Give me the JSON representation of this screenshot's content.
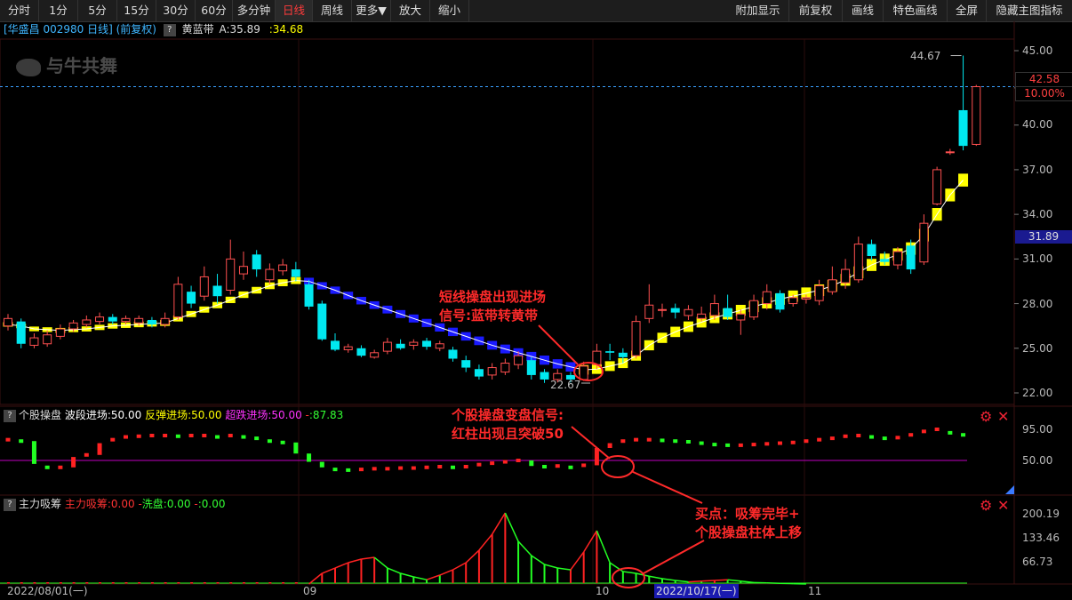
{
  "toolbar": {
    "left": [
      "分时",
      "1分",
      "5分",
      "15分",
      "30分",
      "60分",
      "多分钟",
      "日线",
      "周线",
      "更多▼",
      "放大",
      "缩小"
    ],
    "right": [
      "附加显示",
      "前复权",
      "画线",
      "特色画线",
      "全屏",
      "隐藏主图指标"
    ],
    "active": "日线"
  },
  "info": {
    "stock": "[华盛昌 002980 日线] (前复权)",
    "help": "?",
    "indicator_name": "黄蓝带",
    "a_label": "A:35.89",
    "b_value": ":34.68"
  },
  "watermark": "与牛共舞",
  "price_axis": {
    "ticks": [
      "45.00",
      "42.50",
      "40.00",
      "37.00",
      "34.00",
      "31.00",
      "28.00",
      "25.00",
      "22.00"
    ],
    "tick_values": [
      45.0,
      42.5,
      40.0,
      37.0,
      34.0,
      31.0,
      28.0,
      25.0,
      22.0
    ],
    "current_price": "42.58",
    "current_pct": "10.00%",
    "band_value": "31.89"
  },
  "main_labels": {
    "high": "44.67",
    "low": "22.67"
  },
  "panel2": {
    "name": "个股操盘",
    "wave_label": "波段进场:50.00",
    "rebound_label": "反弹进场:50.00",
    "oversold_label": "超跌进场:50.00",
    "value_label": ":87.83",
    "axis": [
      "95.00",
      "50.00"
    ]
  },
  "panel3": {
    "name": "主力吸筹",
    "main_label": "主力吸筹:0.00",
    "wash_label": "洗盘:0.00",
    "value_label": ":0.00",
    "axis": [
      "200.19",
      "133.46",
      "66.73"
    ]
  },
  "dates": {
    "start": "2022/08/01(一)",
    "sep": "09",
    "oct": "10",
    "cursor": "2022/10/17(一)",
    "nov": "11"
  },
  "annotations": {
    "a1": [
      "短线操盘出现进场",
      "信号:蓝带转黄带"
    ],
    "a2": [
      "个股操盘变盘信号:",
      "红柱出现且突破50"
    ],
    "a3": [
      "买点：吸筹完毕+",
      "个股操盘柱体上移"
    ]
  },
  "colors": {
    "up": "#ff5050",
    "down": "#00e8f0",
    "yellow_band": "#ffff00",
    "blue_band": "#1a1aff",
    "annotation": "#ff2a2a",
    "purple_line": "#c000c0"
  },
  "chart_data": {
    "type": "candlestick",
    "ylim": [
      21.5,
      46.0
    ],
    "candles": [
      {
        "o": 26.5,
        "c": 27.0,
        "h": 27.3,
        "l": 26.2
      },
      {
        "o": 26.8,
        "c": 25.3,
        "h": 27.0,
        "l": 25.0
      },
      {
        "o": 25.2,
        "c": 25.7,
        "h": 26.0,
        "l": 25.0
      },
      {
        "o": 25.3,
        "c": 25.9,
        "h": 26.2,
        "l": 25.1
      },
      {
        "o": 25.8,
        "c": 26.3,
        "h": 26.6,
        "l": 25.6
      },
      {
        "o": 26.3,
        "c": 26.7,
        "h": 26.9,
        "l": 26.1
      },
      {
        "o": 26.6,
        "c": 26.9,
        "h": 27.2,
        "l": 26.4
      },
      {
        "o": 26.8,
        "c": 27.1,
        "h": 27.4,
        "l": 26.6
      },
      {
        "o": 27.1,
        "c": 26.8,
        "h": 27.3,
        "l": 26.6
      },
      {
        "o": 26.8,
        "c": 27.0,
        "h": 27.2,
        "l": 26.6
      },
      {
        "o": 26.7,
        "c": 27.0,
        "h": 27.2,
        "l": 26.5
      },
      {
        "o": 26.9,
        "c": 26.6,
        "h": 27.1,
        "l": 26.4
      },
      {
        "o": 26.6,
        "c": 27.0,
        "h": 27.4,
        "l": 26.4
      },
      {
        "o": 27.1,
        "c": 29.3,
        "h": 29.8,
        "l": 26.9
      },
      {
        "o": 28.8,
        "c": 28.0,
        "h": 29.2,
        "l": 27.7
      },
      {
        "o": 28.5,
        "c": 29.8,
        "h": 30.5,
        "l": 28.2
      },
      {
        "o": 29.2,
        "c": 28.5,
        "h": 30.0,
        "l": 28.0
      },
      {
        "o": 28.9,
        "c": 31.0,
        "h": 32.3,
        "l": 28.6
      },
      {
        "o": 30.0,
        "c": 30.5,
        "h": 31.5,
        "l": 29.6
      },
      {
        "o": 31.3,
        "c": 30.3,
        "h": 31.6,
        "l": 29.8
      },
      {
        "o": 29.6,
        "c": 30.3,
        "h": 30.7,
        "l": 29.3
      },
      {
        "o": 30.2,
        "c": 30.6,
        "h": 31.0,
        "l": 29.9
      },
      {
        "o": 30.3,
        "c": 29.8,
        "h": 30.8,
        "l": 29.5
      },
      {
        "o": 29.3,
        "c": 27.8,
        "h": 29.6,
        "l": 27.6
      },
      {
        "o": 28.0,
        "c": 25.6,
        "h": 28.2,
        "l": 25.5
      },
      {
        "o": 25.5,
        "c": 24.9,
        "h": 26.0,
        "l": 24.8
      },
      {
        "o": 24.9,
        "c": 25.1,
        "h": 25.3,
        "l": 24.7
      },
      {
        "o": 25.0,
        "c": 24.5,
        "h": 25.2,
        "l": 24.4
      },
      {
        "o": 24.4,
        "c": 24.7,
        "h": 24.9,
        "l": 24.3
      },
      {
        "o": 24.8,
        "c": 25.4,
        "h": 25.7,
        "l": 24.6
      },
      {
        "o": 25.3,
        "c": 25.0,
        "h": 25.6,
        "l": 24.9
      },
      {
        "o": 25.2,
        "c": 25.4,
        "h": 25.6,
        "l": 24.9
      },
      {
        "o": 25.5,
        "c": 25.1,
        "h": 25.7,
        "l": 24.9
      },
      {
        "o": 25.0,
        "c": 25.3,
        "h": 25.5,
        "l": 24.8
      },
      {
        "o": 24.9,
        "c": 24.3,
        "h": 25.1,
        "l": 24.1
      },
      {
        "o": 24.2,
        "c": 23.7,
        "h": 24.5,
        "l": 23.4
      },
      {
        "o": 23.6,
        "c": 23.1,
        "h": 23.9,
        "l": 22.9
      },
      {
        "o": 23.2,
        "c": 23.7,
        "h": 24.0,
        "l": 22.9
      },
      {
        "o": 23.4,
        "c": 24.0,
        "h": 24.3,
        "l": 23.2
      },
      {
        "o": 23.9,
        "c": 24.5,
        "h": 24.8,
        "l": 23.6
      },
      {
        "o": 24.2,
        "c": 23.2,
        "h": 24.4,
        "l": 22.9
      },
      {
        "o": 23.4,
        "c": 22.9,
        "h": 23.6,
        "l": 22.67
      },
      {
        "o": 22.9,
        "c": 23.3,
        "h": 23.6,
        "l": 22.7
      },
      {
        "o": 23.2,
        "c": 22.9,
        "h": 23.4,
        "l": 22.7
      },
      {
        "o": 22.9,
        "c": 23.8,
        "h": 24.1,
        "l": 22.8
      },
      {
        "o": 23.9,
        "c": 24.8,
        "h": 25.3,
        "l": 23.6
      },
      {
        "o": 24.8,
        "c": 24.7,
        "h": 25.3,
        "l": 24.2
      },
      {
        "o": 24.7,
        "c": 24.4,
        "h": 25.0,
        "l": 24.0
      },
      {
        "o": 24.5,
        "c": 26.8,
        "h": 27.2,
        "l": 24.3
      },
      {
        "o": 27.0,
        "c": 27.9,
        "h": 29.3,
        "l": 26.7
      },
      {
        "o": 27.6,
        "c": 27.6,
        "h": 28.0,
        "l": 27.1
      },
      {
        "o": 27.7,
        "c": 27.4,
        "h": 28.0,
        "l": 27.0
      },
      {
        "o": 27.2,
        "c": 27.6,
        "h": 27.9,
        "l": 26.9
      },
      {
        "o": 27.0,
        "c": 27.3,
        "h": 27.8,
        "l": 26.8
      },
      {
        "o": 27.2,
        "c": 28.0,
        "h": 28.6,
        "l": 26.9
      },
      {
        "o": 27.7,
        "c": 27.1,
        "h": 28.6,
        "l": 26.9
      },
      {
        "o": 26.9,
        "c": 27.3,
        "h": 27.6,
        "l": 25.9
      },
      {
        "o": 27.1,
        "c": 28.2,
        "h": 28.6,
        "l": 26.9
      },
      {
        "o": 28.0,
        "c": 28.8,
        "h": 29.3,
        "l": 27.6
      },
      {
        "o": 28.7,
        "c": 27.6,
        "h": 28.9,
        "l": 27.4
      },
      {
        "o": 28.0,
        "c": 28.4,
        "h": 28.6,
        "l": 27.8
      },
      {
        "o": 28.3,
        "c": 28.4,
        "h": 28.6,
        "l": 28.0
      },
      {
        "o": 28.2,
        "c": 29.2,
        "h": 29.6,
        "l": 27.9
      },
      {
        "o": 28.8,
        "c": 29.6,
        "h": 30.5,
        "l": 28.6
      },
      {
        "o": 29.4,
        "c": 30.3,
        "h": 31.0,
        "l": 29.0
      },
      {
        "o": 29.6,
        "c": 32.0,
        "h": 32.5,
        "l": 29.4
      },
      {
        "o": 32.0,
        "c": 31.2,
        "h": 32.3,
        "l": 30.9
      },
      {
        "o": 31.0,
        "c": 30.8,
        "h": 31.5,
        "l": 30.6
      },
      {
        "o": 30.6,
        "c": 31.5,
        "h": 31.8,
        "l": 30.3
      },
      {
        "o": 31.9,
        "c": 30.3,
        "h": 32.3,
        "l": 30.0
      },
      {
        "o": 30.8,
        "c": 33.4,
        "h": 34.0,
        "l": 30.6
      },
      {
        "o": 34.7,
        "c": 37.0,
        "h": 37.2,
        "l": 34.6
      },
      {
        "o": 38.2,
        "c": 38.2,
        "h": 38.4,
        "l": 38.0
      },
      {
        "o": 41.0,
        "c": 38.6,
        "h": 44.67,
        "l": 38.3
      },
      {
        "o": 38.7,
        "c": 42.58,
        "h": 42.7,
        "l": 38.6
      }
    ],
    "band": [
      26.6,
      26.5,
      26.3,
      26.25,
      26.2,
      26.25,
      26.3,
      26.4,
      26.5,
      26.55,
      26.6,
      26.65,
      26.7,
      27.0,
      27.3,
      27.6,
      27.9,
      28.25,
      28.6,
      28.9,
      29.2,
      29.4,
      29.55,
      29.5,
      29.2,
      28.9,
      28.55,
      28.2,
      27.9,
      27.6,
      27.3,
      27.0,
      26.7,
      26.4,
      26.1,
      25.8,
      25.5,
      25.2,
      24.95,
      24.7,
      24.45,
      24.2,
      23.95,
      23.75,
      23.55,
      23.6,
      23.8,
      24.0,
      24.5,
      25.2,
      25.7,
      26.1,
      26.45,
      26.75,
      27.05,
      27.3,
      27.55,
      27.8,
      28.05,
      28.3,
      28.5,
      28.7,
      28.9,
      29.2,
      29.6,
      30.1,
      30.6,
      30.95,
      31.3,
      31.7,
      32.6,
      34.0,
      35.3,
      36.3
    ],
    "band_color": [
      "y",
      "y",
      "y",
      "y",
      "y",
      "y",
      "y",
      "y",
      "y",
      "y",
      "y",
      "y",
      "y",
      "y",
      "y",
      "y",
      "y",
      "y",
      "y",
      "y",
      "y",
      "y",
      "y",
      "b",
      "b",
      "b",
      "b",
      "b",
      "b",
      "b",
      "b",
      "b",
      "b",
      "b",
      "b",
      "b",
      "b",
      "b",
      "b",
      "b",
      "b",
      "b",
      "b",
      "b",
      "y",
      "y",
      "y",
      "y",
      "y",
      "y",
      "y",
      "y",
      "y",
      "y",
      "y",
      "y",
      "y",
      "y",
      "y",
      "y",
      "y",
      "y",
      "y",
      "y",
      "y",
      "y",
      "y",
      "y",
      "y",
      "y",
      "y",
      "y",
      "y",
      "y"
    ],
    "osc": [
      80,
      78,
      45,
      40,
      40,
      55,
      58,
      75,
      80,
      84,
      85,
      86,
      86,
      85,
      86,
      86,
      84,
      86,
      84,
      82,
      78,
      76,
      60,
      48,
      40,
      37,
      36,
      37,
      38,
      38,
      39,
      39,
      40,
      41,
      40,
      41,
      44,
      46,
      48,
      50,
      42,
      41,
      42,
      40,
      43,
      68,
      75,
      78,
      80,
      80,
      79,
      78,
      77,
      75,
      73,
      72,
      72,
      73,
      74,
      75,
      76,
      78,
      80,
      82,
      85,
      86,
      84,
      82,
      83,
      87,
      92,
      95,
      90,
      87
    ],
    "bars": [
      0,
      0,
      0,
      0,
      0,
      0,
      0,
      0,
      0,
      0,
      0,
      0,
      0,
      0,
      0,
      0,
      0,
      0,
      0,
      0,
      0,
      0,
      0,
      0,
      30,
      45,
      60,
      70,
      75,
      45,
      30,
      20,
      12,
      25,
      40,
      60,
      95,
      140,
      200,
      120,
      80,
      55,
      45,
      40,
      90,
      150,
      60,
      35,
      30,
      22,
      15,
      10,
      6,
      8,
      10,
      12,
      8,
      4,
      3,
      2,
      1,
      0,
      0,
      0,
      0,
      0,
      0,
      0,
      0,
      0,
      0,
      0,
      0,
      0
    ],
    "bar_up": [
      false,
      false,
      false,
      false,
      false,
      false,
      false,
      false,
      false,
      false,
      false,
      false,
      false,
      false,
      false,
      false,
      false,
      false,
      false,
      false,
      false,
      false,
      false,
      false,
      true,
      true,
      true,
      true,
      true,
      false,
      false,
      false,
      false,
      false,
      true,
      true,
      true,
      true,
      true,
      false,
      false,
      false,
      false,
      true,
      true,
      true,
      false,
      false,
      false,
      false,
      false,
      false,
      false,
      false,
      true,
      false,
      false,
      false,
      false,
      false,
      false,
      false,
      false,
      false,
      false,
      false,
      false,
      false,
      false,
      false,
      false,
      false,
      false,
      false
    ]
  }
}
